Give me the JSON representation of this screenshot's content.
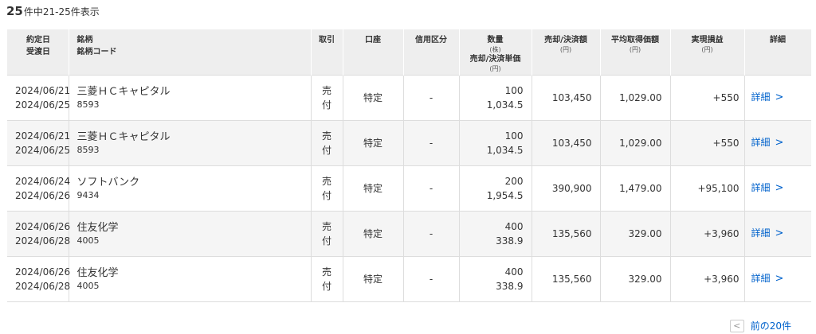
{
  "summary": {
    "total": "25",
    "range_text": "件中21-25件表示"
  },
  "headers": {
    "date_trade": "約定日",
    "date_settle": "受渡日",
    "stock_name": "銘柄",
    "stock_code": "銘柄コード",
    "trade_type": "取引",
    "account": "口座",
    "credit": "信用区分",
    "qty": "数量",
    "qty_unit": "(株)",
    "price": "売却/決済単価",
    "price_unit": "(円)",
    "amount": "売却/決済額",
    "amount_unit": "(円)",
    "avg_cost": "平均取得価額",
    "avg_cost_unit": "(円)",
    "pl": "実現損益",
    "pl_unit": "(円)",
    "detail": "詳細"
  },
  "rows": [
    {
      "trade_date": "2024/06/21",
      "settle_date": "2024/06/25",
      "name": "三菱ＨＣキャピタル",
      "code": "8593",
      "type": "売付",
      "account": "特定",
      "credit": "-",
      "qty": "100",
      "price": "1,034.5",
      "amount": "103,450",
      "avg_cost": "1,029.00",
      "pl": "+550",
      "detail": "詳細"
    },
    {
      "trade_date": "2024/06/21",
      "settle_date": "2024/06/25",
      "name": "三菱ＨＣキャピタル",
      "code": "8593",
      "type": "売付",
      "account": "特定",
      "credit": "-",
      "qty": "100",
      "price": "1,034.5",
      "amount": "103,450",
      "avg_cost": "1,029.00",
      "pl": "+550",
      "detail": "詳細"
    },
    {
      "trade_date": "2024/06/24",
      "settle_date": "2024/06/26",
      "name": "ソフトバンク",
      "code": "9434",
      "type": "売付",
      "account": "特定",
      "credit": "-",
      "qty": "200",
      "price": "1,954.5",
      "amount": "390,900",
      "avg_cost": "1,479.00",
      "pl": "+95,100",
      "detail": "詳細"
    },
    {
      "trade_date": "2024/06/26",
      "settle_date": "2024/06/28",
      "name": "住友化学",
      "code": "4005",
      "type": "売付",
      "account": "特定",
      "credit": "-",
      "qty": "400",
      "price": "338.9",
      "amount": "135,560",
      "avg_cost": "329.00",
      "pl": "+3,960",
      "detail": "詳細"
    },
    {
      "trade_date": "2024/06/26",
      "settle_date": "2024/06/28",
      "name": "住友化学",
      "code": "4005",
      "type": "売付",
      "account": "特定",
      "credit": "-",
      "qty": "400",
      "price": "338.9",
      "amount": "135,560",
      "avg_cost": "329.00",
      "pl": "+3,960",
      "detail": "詳細"
    }
  ],
  "pager": {
    "prev_icon": "chevron-left-icon",
    "prev_label": "前の20件"
  },
  "colors": {
    "profit": "#e6002d",
    "link": "#0062cc",
    "header_bg": "#eeeeee",
    "row_alt": "#f5f5f5"
  }
}
